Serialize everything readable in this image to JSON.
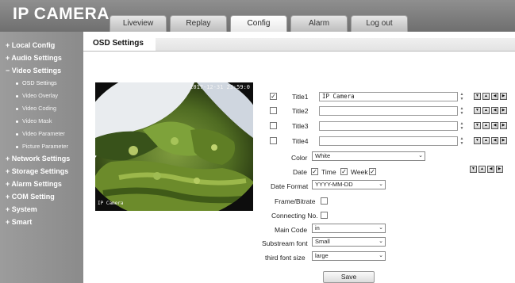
{
  "app": {
    "logo": "IP CAMERA"
  },
  "nav": [
    {
      "label": "Liveview"
    },
    {
      "label": "Replay"
    },
    {
      "label": "Config",
      "active": true
    },
    {
      "label": "Alarm"
    },
    {
      "label": "Log out"
    }
  ],
  "sidebar": {
    "local": "+ Local Config",
    "audio": "+ Audio Settings",
    "video": "− Video Settings",
    "video_items": [
      "OSD Settings",
      "Video Overlay",
      "Video Coding",
      "Video Mask",
      "Video Parameter",
      "Picture Parameter"
    ],
    "network": "+ Network Settings",
    "storage": "+ Storage Settings",
    "alarm": "+ Alarm Settings",
    "com": "+ COM Setting",
    "system": "+ System",
    "smart": "+ Smart"
  },
  "content": {
    "tab": "OSD Settings"
  },
  "preview": {
    "timestamp": "2017-12-31 23:59:0",
    "title_overlay": "IP Camera"
  },
  "titles": [
    {
      "label": "Title1",
      "checked": true,
      "value": "IP Camera"
    },
    {
      "label": "Title2",
      "checked": false,
      "value": ""
    },
    {
      "label": "Title3",
      "checked": false,
      "value": ""
    },
    {
      "label": "Title4",
      "checked": false,
      "value": ""
    }
  ],
  "arrow_icons": [
    "arrow-down-icon",
    "arrow-up-icon",
    "arrow-left-icon",
    "arrow-right-icon"
  ],
  "form": {
    "color_label": "Color",
    "color_value": "White",
    "date_label": "Date",
    "date_checked": true,
    "time_label": "Time",
    "time_checked": true,
    "week_label": "Week",
    "week_checked": true,
    "date_format_label": "Date Format",
    "date_format_value": "YYYY-MM-DD",
    "frame_bitrate_label": "Frame/Bitrate",
    "frame_bitrate_checked": false,
    "connecting_label": "Connecting No.",
    "connecting_checked": false,
    "main_code_label": "Main Code",
    "main_code_value": "in",
    "substream_font_label": "Substream font",
    "substream_font_value": "Small",
    "third_font_label": "third font size",
    "third_font_value": "large",
    "save_label": "Save"
  }
}
